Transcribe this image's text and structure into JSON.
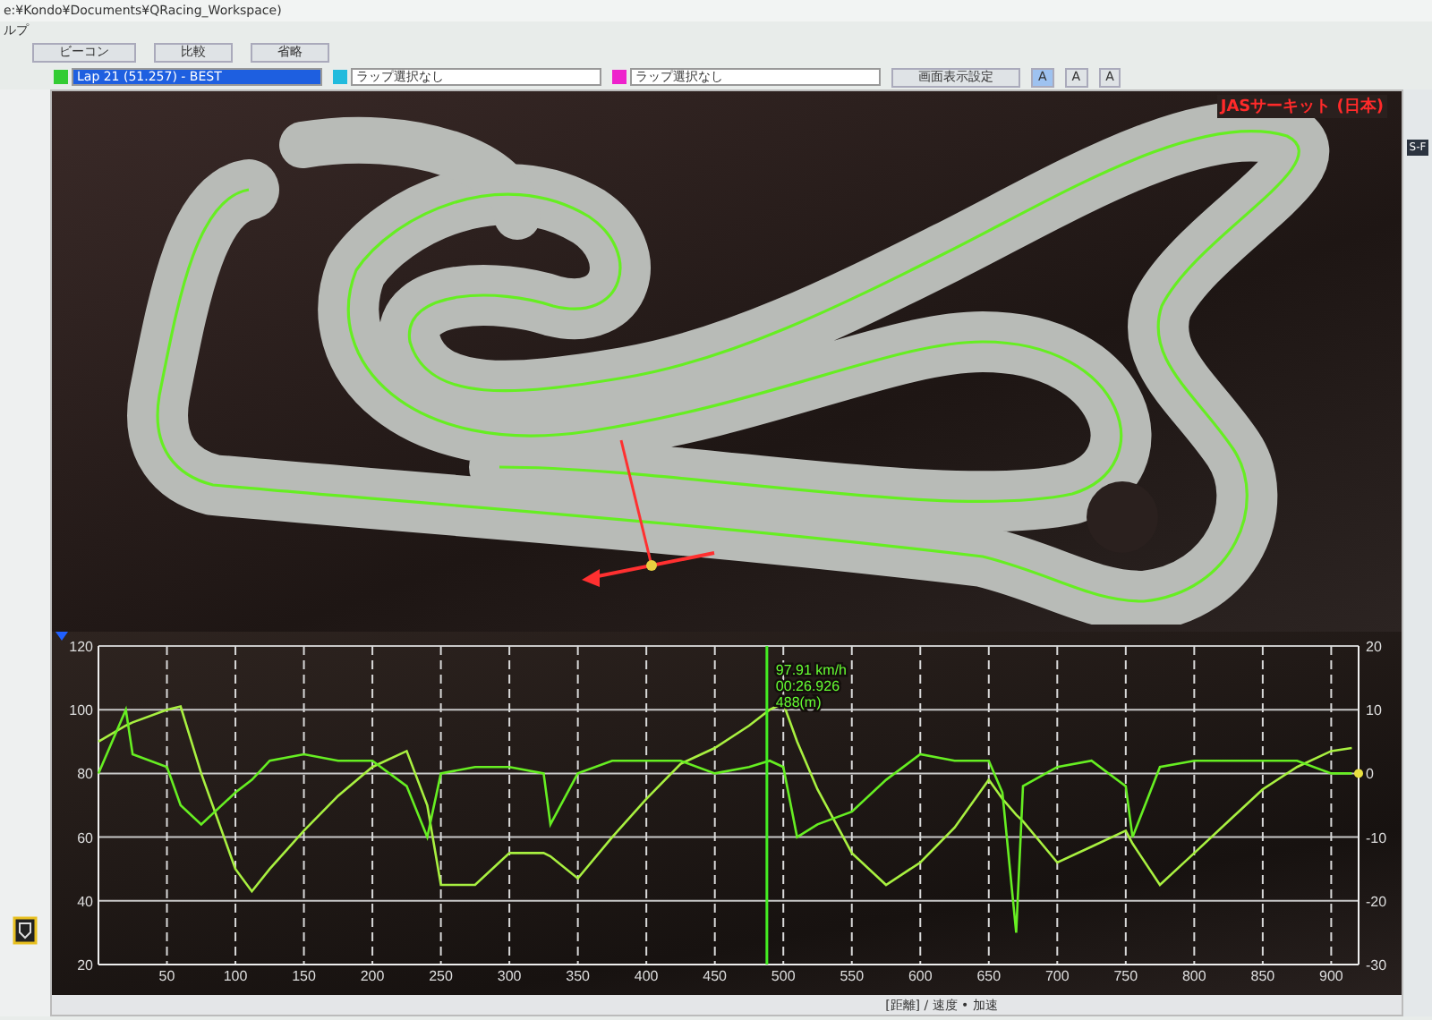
{
  "window": {
    "title": "e:¥Kondo¥Documents¥QRacing_Workspace)"
  },
  "menu": [
    "ルプ"
  ],
  "toolbar": {
    "buttons": [
      "ビーコン",
      "比較",
      "省略"
    ]
  },
  "lap_selectors": [
    {
      "value": "Lap 21 (51.257) - BEST",
      "color": "#33cc33",
      "selected": true
    },
    {
      "value": "ラップ選択なし",
      "color": "#22bbdd",
      "selected": false
    },
    {
      "value": "ラップ選択なし",
      "color": "#ee22cc",
      "selected": false
    }
  ],
  "display_settings_button": "画面表示設定",
  "font_buttons": [
    {
      "label": "A",
      "selected": true
    },
    {
      "label": "A",
      "selected": false
    },
    {
      "label": "A",
      "selected": false
    }
  ],
  "track": {
    "circuit_name": "JASサーキット (日本)"
  },
  "side_panel": {
    "label": "S-F"
  },
  "chart": {
    "footer": "[距離] / 速度 • 加速",
    "chart_data": {
      "type": "line",
      "xlim": [
        0,
        920
      ],
      "ylim": [
        20,
        120
      ],
      "y2lim": [
        -30,
        20
      ],
      "xticks": [
        50,
        100,
        150,
        200,
        250,
        300,
        350,
        400,
        450,
        500,
        550,
        600,
        650,
        700,
        750,
        800,
        850,
        900
      ],
      "yticks": [
        20,
        40,
        60,
        80,
        100,
        120
      ],
      "y2ticks": [
        -30,
        -20,
        -10,
        0,
        10,
        20
      ],
      "x": [
        0,
        20,
        25,
        50,
        60,
        75,
        100,
        112,
        125,
        150,
        175,
        200,
        225,
        240,
        250,
        275,
        300,
        325,
        330,
        350,
        375,
        400,
        425,
        450,
        475,
        490,
        500,
        510,
        525,
        550,
        575,
        600,
        625,
        650,
        660,
        670,
        675,
        700,
        725,
        750,
        755,
        775,
        800,
        825,
        850,
        875,
        900,
        915
      ],
      "series": [
        {
          "color": "#a8f040",
          "values": [
            90,
            95,
            96,
            100,
            101,
            80,
            50,
            43,
            50,
            62,
            73,
            82,
            87,
            70,
            45,
            45,
            55,
            55,
            54,
            47,
            60,
            72,
            83,
            88,
            95,
            100,
            102,
            90,
            75,
            55,
            45,
            52,
            63,
            78,
            72,
            67,
            65,
            52,
            57,
            62,
            58,
            45,
            55,
            65,
            75,
            82,
            87,
            88
          ]
        },
        {
          "color": "#66ee22",
          "axis": "y2",
          "values": [
            0,
            10,
            3,
            1,
            -5,
            -8,
            -3,
            -1,
            2,
            3,
            2,
            2,
            -2,
            -10,
            0,
            1,
            1,
            0,
            -8,
            0,
            2,
            2,
            2,
            0,
            1,
            2,
            1,
            -10,
            -8,
            -6,
            -1,
            3,
            2,
            2,
            -3,
            -25,
            -2,
            1,
            2,
            -2,
            -10,
            1,
            2,
            2,
            2,
            2,
            0,
            0
          ]
        }
      ],
      "grid": true,
      "ref_lines": [
        {
          "value": 488,
          "axis": "x",
          "color": "#44ee22"
        }
      ],
      "annotations": [
        "97.91 km/h",
        "00:26.926",
        "488(m)"
      ]
    }
  }
}
